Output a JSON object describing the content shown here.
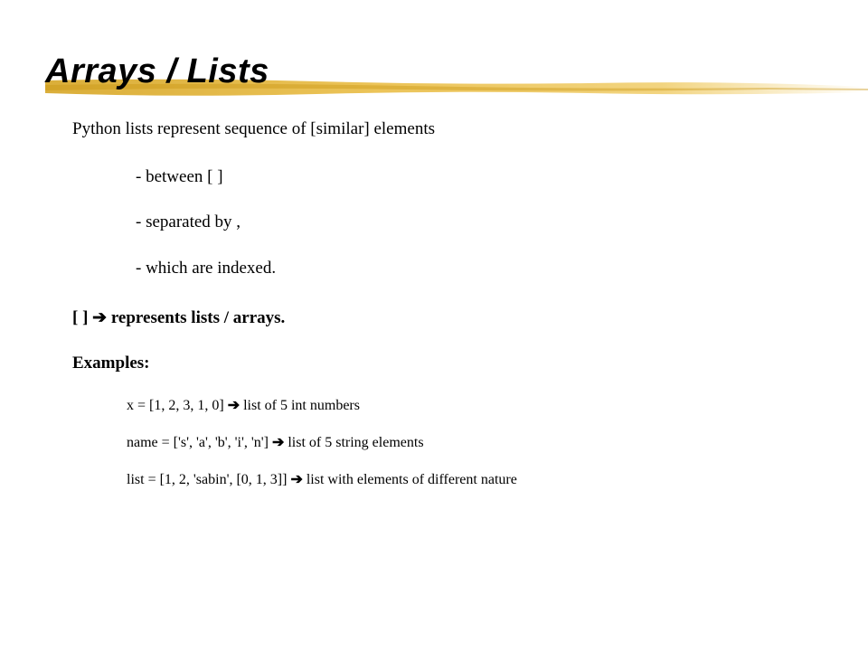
{
  "title": "Arrays / Lists",
  "intro": "Python lists represent sequence of [similar] elements",
  "bullets": {
    "b1": "- between [ ]",
    "b2": "- separated by ,",
    "b3": "- which are indexed."
  },
  "arrow": "➔",
  "bracketLine": {
    "prefix": "[ ] ",
    "suffix": " represents lists / arrays."
  },
  "examplesHeader": "Examples:",
  "examples": {
    "e1": {
      "code": "x = [1, 2, 3, 1, 0] ",
      "desc": " list of 5 int numbers"
    },
    "e2": {
      "code": "name = ['s', 'a', 'b', 'i', 'n'] ",
      "desc": " list of 5 string elements"
    },
    "e3": {
      "code": "list = [1, 2, 'sabin', [0, 1, 3]] ",
      "desc": " list with elements of different nature"
    }
  }
}
